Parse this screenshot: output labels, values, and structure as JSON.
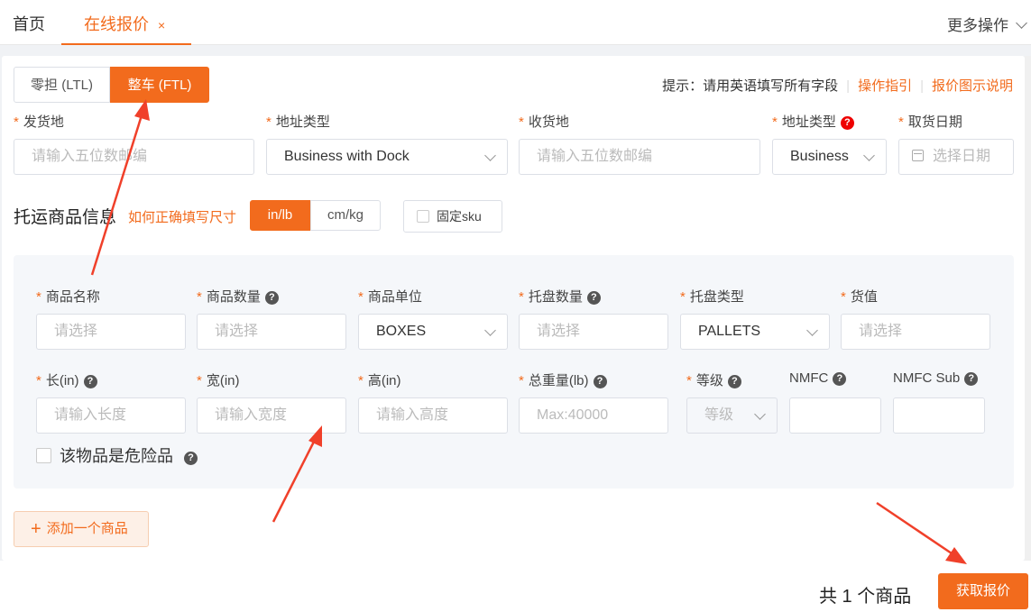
{
  "tabs": {
    "home": "首页",
    "active": "在线报价",
    "close": "×",
    "more": "更多操作"
  },
  "mode": {
    "ltl": "零担 (LTL)",
    "ftl": "整车 (FTL)"
  },
  "hint": {
    "text": "提示：请用英语填写所有字段",
    "guide": "操作指引",
    "legend": "报价图示说明"
  },
  "shipping": {
    "origin_label": "发货地",
    "origin_placeholder": "请输入五位数邮编",
    "origin_type_label": "地址类型",
    "origin_type_value": "Business with Dock",
    "dest_label": "收货地",
    "dest_placeholder": "请输入五位数邮编",
    "dest_type_label": "地址类型",
    "dest_type_value": "Business",
    "pickup_label": "取货日期",
    "pickup_placeholder": "选择日期"
  },
  "goods": {
    "title": "托运商品信息",
    "size_link": "如何正确填写尺寸",
    "unit_in": "in/lb",
    "unit_cm": "cm/kg",
    "fixed_sku": "固定sku",
    "name_label": "商品名称",
    "name_placeholder": "请选择",
    "qty_label": "商品数量",
    "qty_placeholder": "请选择",
    "unit_label": "商品单位",
    "unit_value": "BOXES",
    "pallet_qty_label": "托盘数量",
    "pallet_qty_placeholder": "请选择",
    "pallet_type_label": "托盘类型",
    "pallet_type_value": "PALLETS",
    "value_label": "货值",
    "value_placeholder": "请选择",
    "length_label": "长(in)",
    "length_placeholder": "请输入长度",
    "width_label": "宽(in)",
    "width_placeholder": "请输入宽度",
    "height_label": "高(in)",
    "height_placeholder": "请输入高度",
    "weight_label": "总重量(lb)",
    "weight_placeholder": "Max:40000",
    "class_label": "等级",
    "class_placeholder": "等级",
    "nmfc_label": "NMFC",
    "nmfc_sub_label": "NMFC Sub",
    "danger_label": "该物品是危险品",
    "add_item": "添加一个商品"
  },
  "footer": {
    "total": "共 1 个商品",
    "quote": "获取报价"
  },
  "colors": {
    "accent": "#f26b1d",
    "annotation_arrow": "#f0402a"
  }
}
